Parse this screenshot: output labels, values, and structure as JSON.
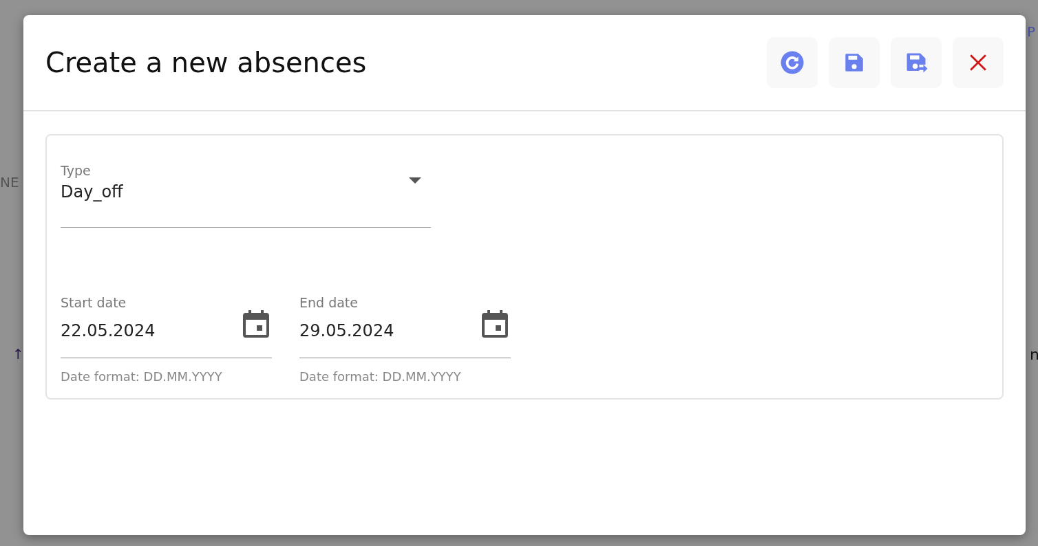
{
  "background": {
    "link_fragment": "P",
    "tab_fragment": "NE",
    "sort_arrow": "↑",
    "cell_fragment": "n"
  },
  "dialog": {
    "title": "Create a new absences",
    "actions": [
      {
        "kind": "reset"
      },
      {
        "kind": "save"
      },
      {
        "kind": "save_as"
      },
      {
        "kind": "close"
      }
    ],
    "type_field": {
      "label": "Type",
      "value": "Day_off"
    },
    "date_fields": [
      {
        "label": "Start date",
        "value": "22.05.2024",
        "helper": "Date format: DD.MM.YYYY"
      },
      {
        "label": "End date",
        "value": "29.05.2024",
        "helper": "Date format: DD.MM.YYYY"
      }
    ]
  }
}
